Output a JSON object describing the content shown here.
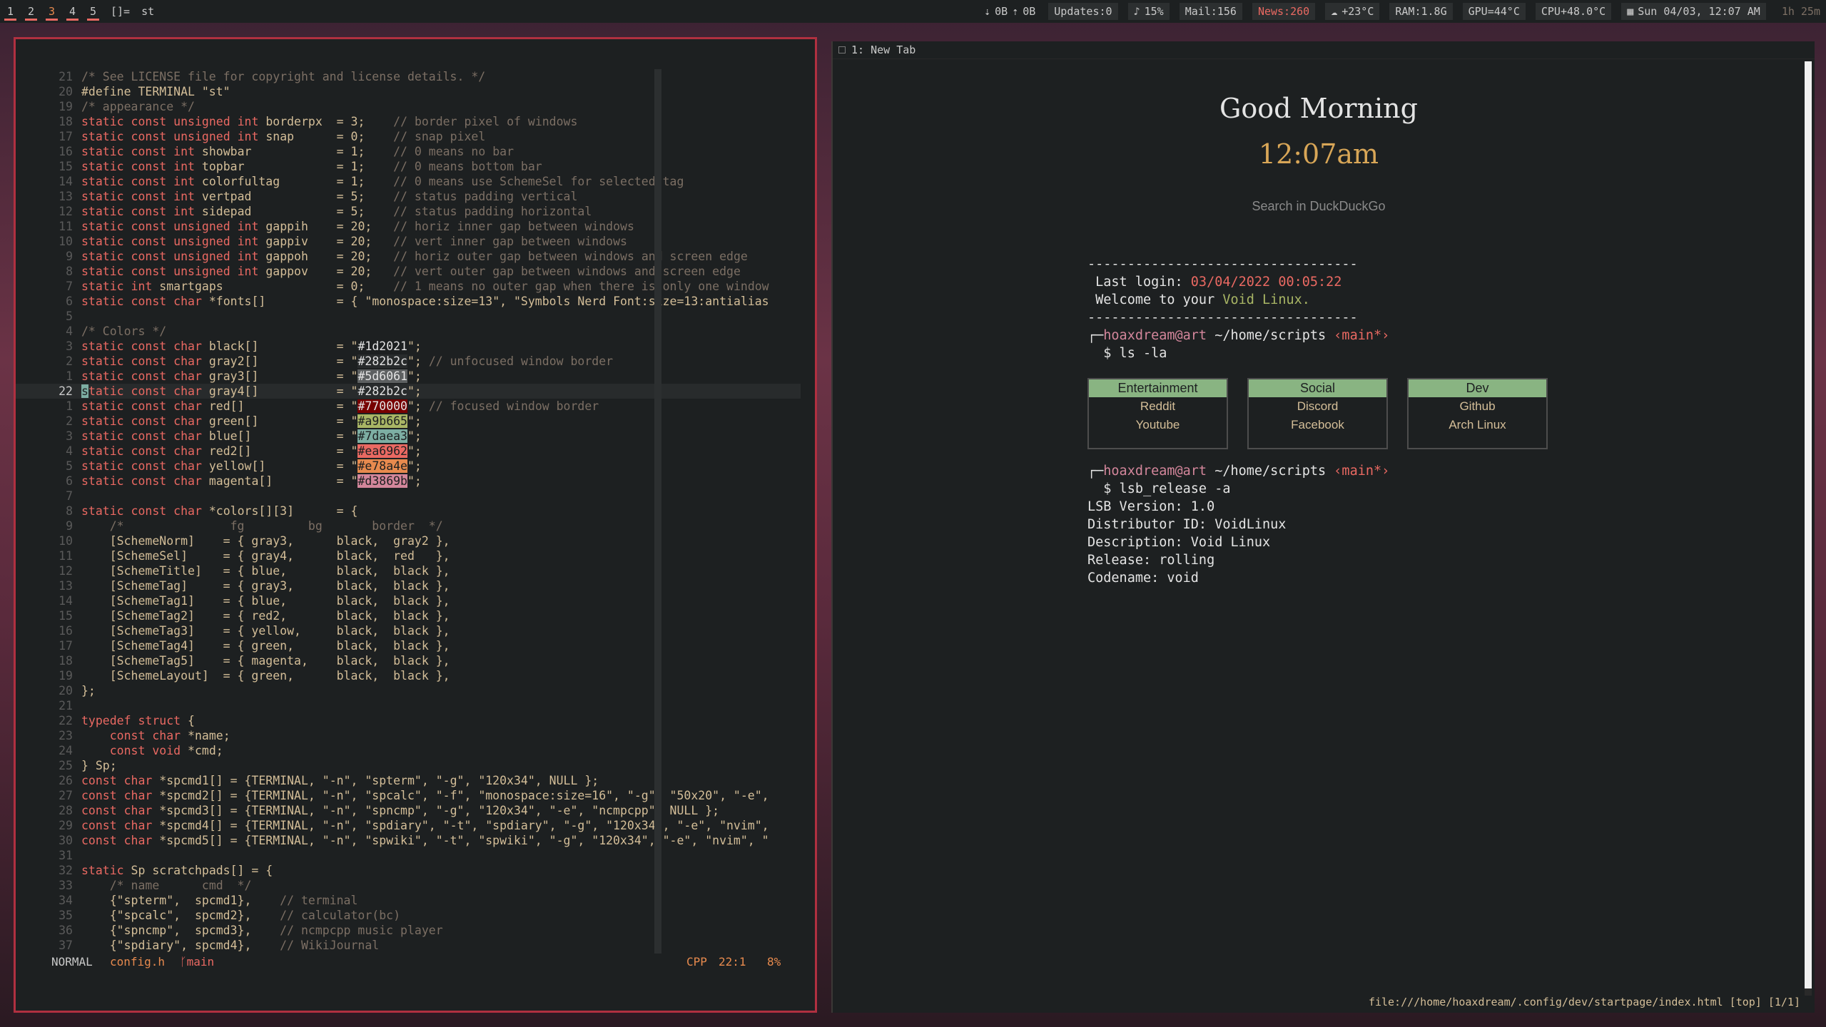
{
  "bar": {
    "tags": [
      "1",
      "2",
      "3",
      "4",
      "5"
    ],
    "layout": "[]=",
    "window_title": "st",
    "net_down": "0B",
    "net_up": "0B",
    "updates": "Updates:0",
    "volume": "15%",
    "mail": "Mail:156",
    "news": "News:260",
    "weather": "+23°C",
    "ram": "RAM:1.8G",
    "gpu": "GPU=44°C",
    "cpu": "CPU+48.0°C",
    "datetime": "Sun 04/03, 12:07 AM",
    "uptime": "1h 25m"
  },
  "vim": {
    "mode": "NORMAL",
    "file": "config.h",
    "branch": "main",
    "filetype": "CPP",
    "position": "22:1",
    "percent": "8%",
    "lines": [
      [
        "21",
        "/* See LICENSE file for copyright and license details. */"
      ],
      [
        "20",
        "#define TERMINAL \"st\""
      ],
      [
        "19",
        "/* appearance */"
      ],
      [
        "18",
        "static const unsigned int borderpx  = 3;    // border pixel of windows"
      ],
      [
        "17",
        "static const unsigned int snap      = 0;    // snap pixel"
      ],
      [
        "16",
        "static const int showbar            = 1;    // 0 means no bar"
      ],
      [
        "15",
        "static const int topbar             = 1;    // 0 means bottom bar"
      ],
      [
        "14",
        "static const int colorfultag        = 1;    // 0 means use SchemeSel for selected tag"
      ],
      [
        "13",
        "static const int vertpad            = 5;    // status padding vertical"
      ],
      [
        "12",
        "static const int sidepad            = 5;    // status padding horizontal"
      ],
      [
        "11",
        "static const unsigned int gappih    = 20;   // horiz inner gap between windows"
      ],
      [
        "10",
        "static const unsigned int gappiv    = 20;   // vert inner gap between windows"
      ],
      [
        "9",
        "static const unsigned int gappoh    = 20;   // horiz outer gap between windows and screen edge"
      ],
      [
        "8",
        "static const unsigned int gappov    = 20;   // vert outer gap between windows and screen edge"
      ],
      [
        "7",
        "static int smartgaps                = 0;    // 1 means no outer gap when there is only one window"
      ],
      [
        "6",
        "static const char *fonts[]          = { \"monospace:size=13\", \"Symbols Nerd Font:size=13:antialias"
      ],
      [
        "5",
        ""
      ],
      [
        "4",
        "/* Colors */"
      ],
      [
        "3",
        "static const char black[]           = \"#1d2021\";"
      ],
      [
        "2",
        "static const char gray2[]           = \"#282b2c\"; // unfocused window border"
      ],
      [
        "1",
        "static const char gray3[]           = \"#5d6061\";"
      ],
      [
        "22",
        "static const char gray4[]           = \"#282b2c\";"
      ],
      [
        "1",
        "static const char red[]             = \"#770000\"; // focused window border"
      ],
      [
        "2",
        "static const char green[]           = \"#a9b665\";"
      ],
      [
        "3",
        "static const char blue[]            = \"#7daea3\";"
      ],
      [
        "4",
        "static const char red2[]            = \"#ea6962\";"
      ],
      [
        "5",
        "static const char yellow[]          = \"#e78a4e\";"
      ],
      [
        "6",
        "static const char magenta[]         = \"#d3869b\";"
      ],
      [
        "7",
        ""
      ],
      [
        "8",
        "static const char *colors[][3]      = {"
      ],
      [
        "9",
        "    /*               fg         bg       border  */"
      ],
      [
        "10",
        "    [SchemeNorm]    = { gray3,      black,  gray2 },"
      ],
      [
        "11",
        "    [SchemeSel]     = { gray4,      black,  red   },"
      ],
      [
        "12",
        "    [SchemeTitle]   = { blue,       black,  black },"
      ],
      [
        "13",
        "    [SchemeTag]     = { gray3,      black,  black },"
      ],
      [
        "14",
        "    [SchemeTag1]    = { blue,       black,  black },"
      ],
      [
        "15",
        "    [SchemeTag2]    = { red2,       black,  black },"
      ],
      [
        "16",
        "    [SchemeTag3]    = { yellow,     black,  black },"
      ],
      [
        "17",
        "    [SchemeTag4]    = { green,      black,  black },"
      ],
      [
        "18",
        "    [SchemeTag5]    = { magenta,    black,  black },"
      ],
      [
        "19",
        "    [SchemeLayout]  = { green,      black,  black },"
      ],
      [
        "20",
        "};"
      ],
      [
        "21",
        ""
      ],
      [
        "22",
        "typedef struct {"
      ],
      [
        "23",
        "    const char *name;"
      ],
      [
        "24",
        "    const void *cmd;"
      ],
      [
        "25",
        "} Sp;"
      ],
      [
        "26",
        "const char *spcmd1[] = {TERMINAL, \"-n\", \"spterm\", \"-g\", \"120x34\", NULL };"
      ],
      [
        "27",
        "const char *spcmd2[] = {TERMINAL, \"-n\", \"spcalc\", \"-f\", \"monospace:size=16\", \"-g\", \"50x20\", \"-e\","
      ],
      [
        "28",
        "const char *spcmd3[] = {TERMINAL, \"-n\", \"spncmp\", \"-g\", \"120x34\", \"-e\", \"ncmpcpp\", NULL };"
      ],
      [
        "29",
        "const char *spcmd4[] = {TERMINAL, \"-n\", \"spdiary\", \"-t\", \"spdiary\", \"-g\", \"120x34\", \"-e\", \"nvim\","
      ],
      [
        "30",
        "const char *spcmd5[] = {TERMINAL, \"-n\", \"spwiki\", \"-t\", \"spwiki\", \"-g\", \"120x34\", \"-e\", \"nvim\", \""
      ],
      [
        "31",
        ""
      ],
      [
        "32",
        "static Sp scratchpads[] = {"
      ],
      [
        "33",
        "    /* name      cmd  */"
      ],
      [
        "34",
        "    {\"spterm\",  spcmd1},    // terminal"
      ],
      [
        "35",
        "    {\"spcalc\",  spcmd2},    // calculator(bc)"
      ],
      [
        "36",
        "    {\"spncmp\",  spcmd3},    // ncmpcpp music player"
      ],
      [
        "37",
        "    {\"spdiary\", spcmd4},    // WikiJournal"
      ]
    ]
  },
  "browser": {
    "tab_label": "1: New Tab",
    "greeting": "Good Morning",
    "time": "12:07am",
    "search_placeholder": "Search in DuckDuckGo",
    "dashes": "----------------------------------",
    "last_login_label": "Last login: ",
    "last_login_value": "03/04/2022 00:05:22",
    "welcome_prefix": "Welcome to your ",
    "welcome_distro": "Void Linux.",
    "prompt_user": "hoaxdream@art",
    "prompt_path": " ~/home/scripts ",
    "prompt_branch": "‹main*›",
    "cmd1": "$ ls -la",
    "cmd2": "$ lsb_release -a",
    "cards": [
      {
        "title": "Entertainment",
        "links": [
          "Reddit",
          "Youtube"
        ]
      },
      {
        "title": "Social",
        "links": [
          "Discord",
          "Facebook"
        ]
      },
      {
        "title": "Dev",
        "links": [
          "Github",
          "Arch Linux"
        ]
      }
    ],
    "lsb": [
      "LSB Version: 1.0",
      "Distributor ID: VoidLinux",
      "Description: Void Linux",
      "Release: rolling",
      "Codename: void"
    ],
    "url_status": "file:///home/hoaxdream/.config/dev/startpage/index.html [top] [1/1]"
  }
}
